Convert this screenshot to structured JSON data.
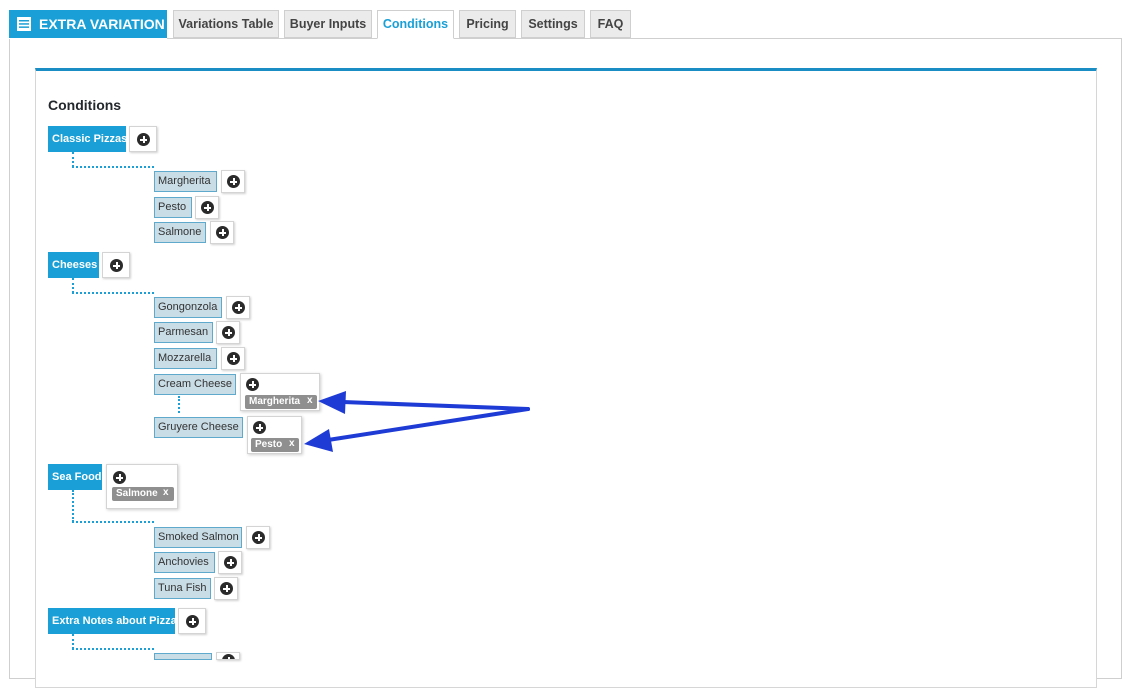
{
  "header": {
    "brand": "EXTRA VARIATION",
    "tabs": [
      "Variations Table",
      "Buyer Inputs",
      "Conditions",
      "Pricing",
      "Settings",
      "FAQ"
    ],
    "active_tab": "Conditions"
  },
  "panel": {
    "title": "Conditions"
  },
  "groups": [
    {
      "label": "Classic Pizzas",
      "items": [
        "Margherita",
        "Pesto",
        "Salmone"
      ]
    },
    {
      "label": "Cheeses",
      "items": [
        "Gongonzola",
        "Parmesan",
        "Mozzarella",
        "Cream Cheese",
        "Gruyere Cheese"
      ]
    },
    {
      "label": "Sea Food",
      "items": [
        "Smoked Salmon",
        "Anchovies",
        "Tuna Fish"
      ]
    },
    {
      "label": "Extra Notes about Pizza",
      "items": []
    }
  ],
  "tags": {
    "cream_cheese": "Margherita",
    "gruyere_cheese": "Pesto",
    "sea_food": "Salmone",
    "remove": "x"
  },
  "colors": {
    "accent": "#1aa0d6",
    "panel_border": "#1a8ec4",
    "sub_item_bg": "#c9dde6",
    "tag_bg": "#8f8f8f",
    "arrow": "#1f3bd6"
  },
  "icons": {
    "brand": "list-icon",
    "add": "plus-circle-icon"
  }
}
